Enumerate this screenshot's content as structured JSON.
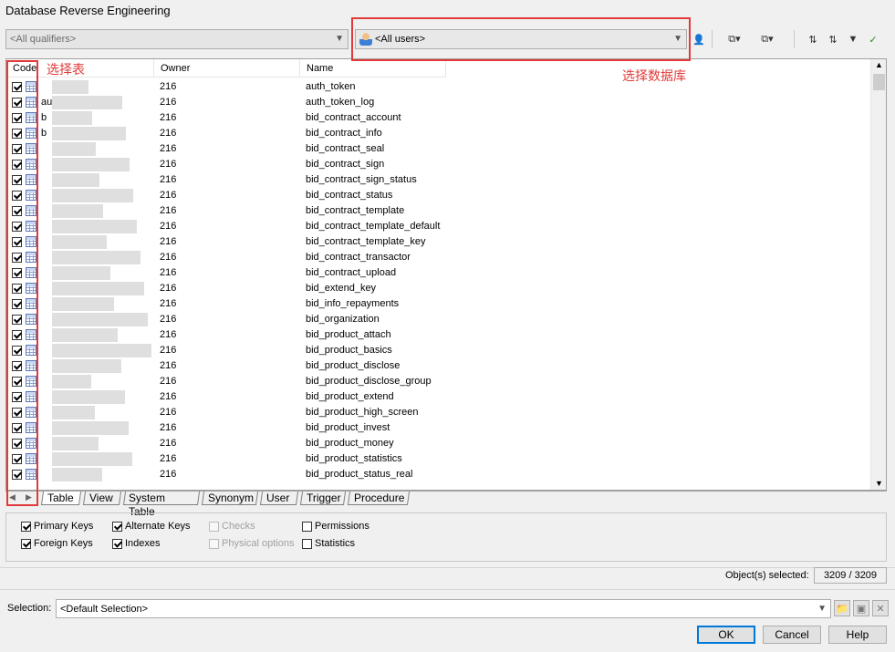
{
  "window": {
    "title": "Database Reverse Engineering"
  },
  "toolbar": {
    "qualifier_combo": "<All qualifiers>",
    "users_combo": "<All users>",
    "icons": [
      "user-select-icon",
      "select-all-icon",
      "deselect-all-icon",
      "move-up-icon",
      "move-down-icon",
      "filter-icon",
      "filter-clear-icon"
    ]
  },
  "annotations": {
    "select_table": "选择表",
    "select_database": "选择数据库"
  },
  "columns": {
    "code": "Code",
    "owner": "Owner",
    "name": "Name"
  },
  "rows": [
    {
      "code": "",
      "owner": "216",
      "name": "auth_token"
    },
    {
      "code": "au",
      "owner": "216",
      "name": "auth_token_log"
    },
    {
      "code": "b",
      "owner": "216",
      "name": "bid_contract_account"
    },
    {
      "code": "b",
      "owner": "216",
      "name": "bid_contract_info"
    },
    {
      "code": "",
      "owner": "216",
      "name": "bid_contract_seal"
    },
    {
      "code": "",
      "owner": "216",
      "name": "bid_contract_sign"
    },
    {
      "code": "",
      "owner": "216",
      "name": "bid_contract_sign_status"
    },
    {
      "code": "",
      "owner": "216",
      "name": "bid_contract_status"
    },
    {
      "code": "",
      "owner": "216",
      "name": "bid_contract_template"
    },
    {
      "code": "",
      "owner": "216",
      "name": "bid_contract_template_default"
    },
    {
      "code": "",
      "owner": "216",
      "name": "bid_contract_template_key"
    },
    {
      "code": "",
      "owner": "216",
      "name": "bid_contract_transactor"
    },
    {
      "code": "",
      "owner": "216",
      "name": "bid_contract_upload"
    },
    {
      "code": "",
      "owner": "216",
      "name": "bid_extend_key"
    },
    {
      "code": "",
      "owner": "216",
      "name": "bid_info_repayments"
    },
    {
      "code": "",
      "owner": "216",
      "name": "bid_organization"
    },
    {
      "code": "",
      "owner": "216",
      "name": "bid_product_attach"
    },
    {
      "code": "",
      "owner": "216",
      "name": "bid_product_basics"
    },
    {
      "code": "",
      "owner": "216",
      "name": "bid_product_disclose"
    },
    {
      "code": "",
      "owner": "216",
      "name": "bid_product_disclose_group"
    },
    {
      "code": "",
      "owner": "216",
      "name": "bid_product_extend"
    },
    {
      "code": "",
      "owner": "216",
      "name": "bid_product_high_screen"
    },
    {
      "code": "",
      "owner": "216",
      "name": "bid_product_invest"
    },
    {
      "code": "",
      "owner": "216",
      "name": "bid_product_money"
    },
    {
      "code": "",
      "owner": "216",
      "name": "bid_product_statistics"
    },
    {
      "code": "",
      "owner": "216",
      "name": "bid_product_status_real"
    }
  ],
  "tabs": [
    "Table",
    "View",
    "System Table",
    "Synonym",
    "User",
    "Trigger",
    "Procedure"
  ],
  "options": [
    {
      "label": "Primary Keys",
      "checked": true,
      "enabled": true
    },
    {
      "label": "Alternate Keys",
      "checked": true,
      "enabled": true
    },
    {
      "label": "Checks",
      "checked": false,
      "enabled": false
    },
    {
      "label": "Permissions",
      "checked": false,
      "enabled": true
    },
    {
      "label": "Foreign Keys",
      "checked": true,
      "enabled": true
    },
    {
      "label": "Indexes",
      "checked": true,
      "enabled": true
    },
    {
      "label": "Physical options",
      "checked": false,
      "enabled": false
    },
    {
      "label": "Statistics",
      "checked": false,
      "enabled": true
    }
  ],
  "status": {
    "label": "Object(s) selected:",
    "value": "3209 / 3209"
  },
  "selection": {
    "label": "Selection:",
    "value": "<Default Selection>"
  },
  "buttons": {
    "ok": "OK",
    "cancel": "Cancel",
    "help": "Help"
  }
}
